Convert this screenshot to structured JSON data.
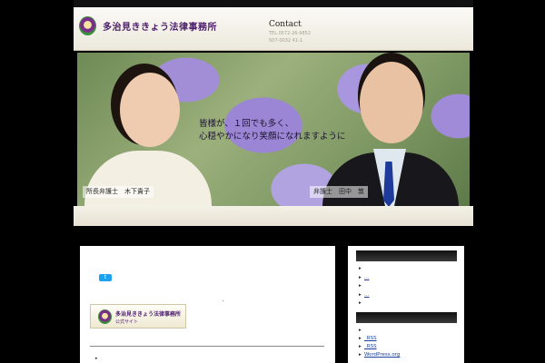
{
  "header": {
    "site_title": "多治見ききょう法律事務所",
    "contact": {
      "title": "Contact",
      "tel1": "TEL.0572-26-9852",
      "tel2": "507-0032 41-1"
    }
  },
  "hero": {
    "tagline_line1": "皆様が、１回でも多く、",
    "tagline_line2": "心穏やかになり笑顔になれますように",
    "caption_left": "所長弁護士　木下貴子",
    "caption_right": "弁護士　田中　敦"
  },
  "main": {
    "tweet_label": "t",
    "banner": {
      "title": "多治見ききょう法律事務所",
      "subtitle": "公式サイト"
    },
    "list_marker": "▸"
  },
  "sidebar": {
    "group1": [
      {
        "arrow": "▸",
        "label": ""
      },
      {
        "arrow": "▸",
        "label": "…"
      },
      {
        "arrow": "▸",
        "label": ""
      },
      {
        "arrow": "▸",
        "label": "…"
      },
      {
        "arrow": "▸",
        "label": ""
      }
    ],
    "group2": [
      {
        "arrow": "▸",
        "label": ""
      },
      {
        "arrow": "▸",
        "label": "_RSS"
      },
      {
        "arrow": "▸",
        "label": "_RSS"
      },
      {
        "arrow": "▸",
        "label": "WordPress.org"
      }
    ]
  }
}
